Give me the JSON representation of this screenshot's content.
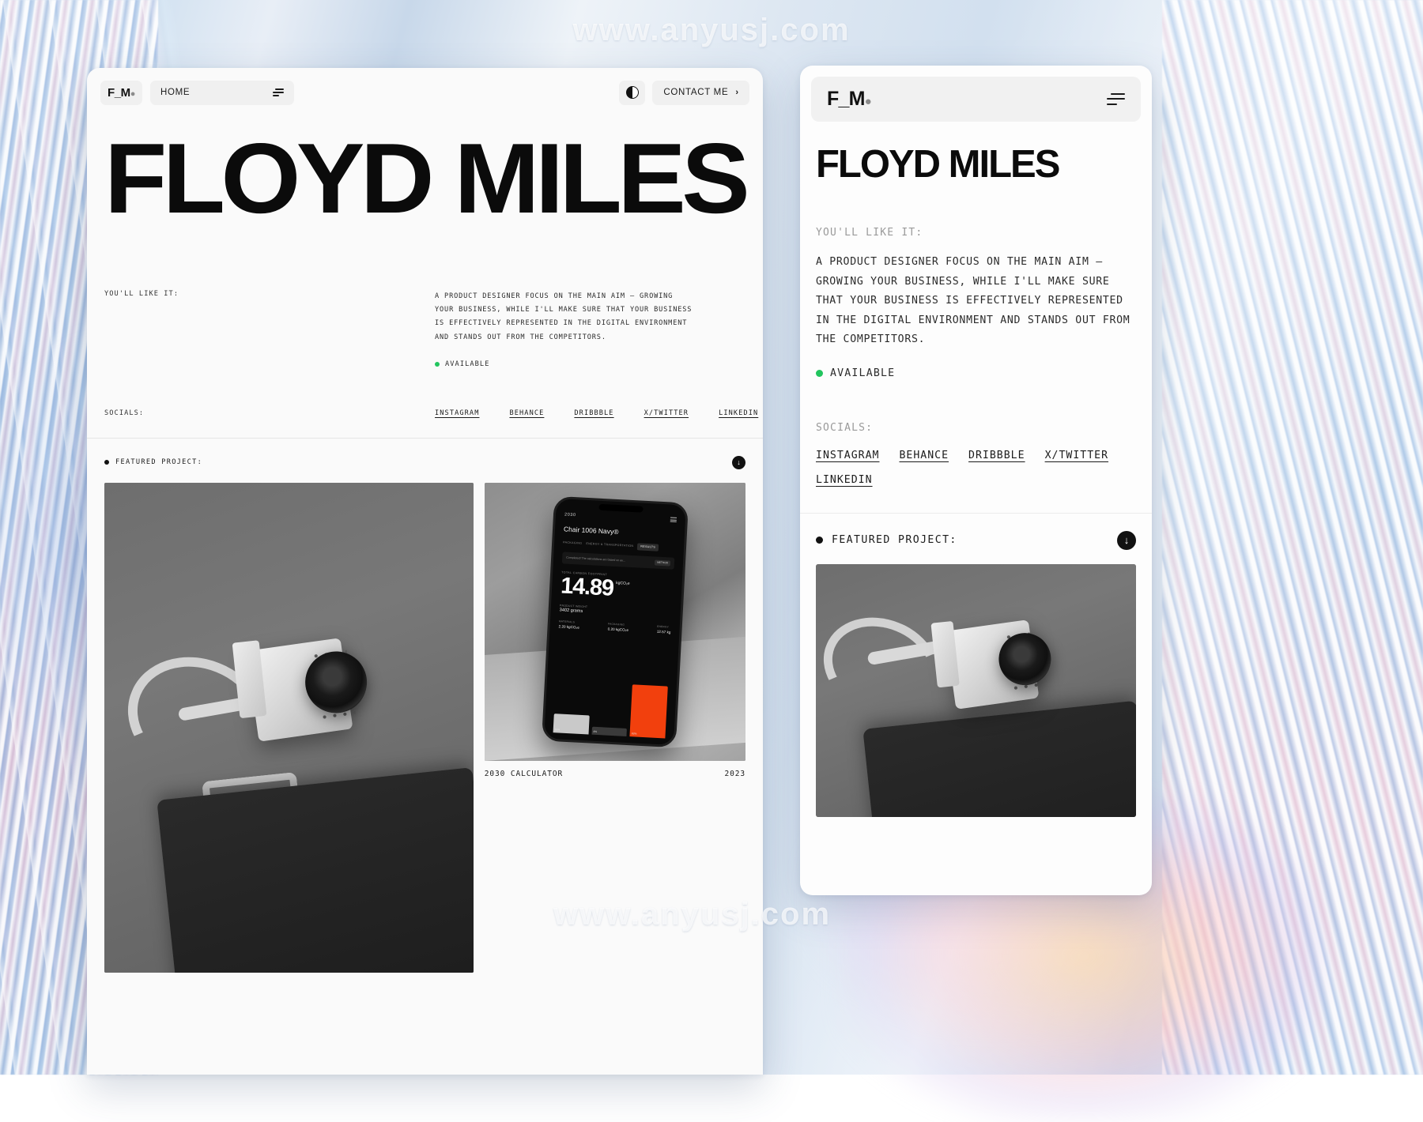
{
  "watermark": {
    "top": "www.anyusj.com",
    "mid": "www.anyusj.com"
  },
  "desktop": {
    "nav": {
      "logo": "F_M",
      "logo_dot": "●",
      "home_label": "HOME",
      "filter_icon": "filter-lines-icon",
      "theme_icon": "contrast-circle-icon",
      "contact_label": "CONTACT ME",
      "contact_chevron": "›"
    },
    "hero": {
      "title": "FLOYD MILES"
    },
    "intro": {
      "label": "YOU'LL LIKE IT:",
      "description": "A PRODUCT DESIGNER FOCUS ON THE MAIN AIM — GROWING YOUR BUSINESS, WHILE I'LL MAKE SURE THAT YOUR BUSINESS IS EFFECTIVELY REPRESENTED IN THE DIGITAL ENVIRONMENT AND STANDS OUT FROM THE COMPETITORS.",
      "status": "AVAILABLE",
      "status_color": "#22c55e"
    },
    "socials": {
      "label": "SOCIALS:",
      "links": [
        "INSTAGRAM",
        "BEHANCE",
        "DRIBBBLE",
        "X/TWITTER",
        "LINKEDIN"
      ]
    },
    "featured": {
      "label": "FEATURED PROJECT:",
      "download_icon": "download-arrow-icon",
      "download_glyph": "↓",
      "project_caption": "2030 CALCULATOR",
      "project_year": "2023"
    },
    "phone_mockup": {
      "brand": "2030",
      "title": "Chair 1006 Navy®",
      "tabs": [
        "PACKAGING",
        "ENERGY & TRANSPORTATION",
        "RESULTS"
      ],
      "active_tab": "RESULTS",
      "note": "Completed! The calculations are based on av...",
      "note_badge": "METHOD",
      "metric_label": "TOTAL CARBON FOOTPRINT",
      "metric_value": "14.89",
      "metric_unit": "kgCO₂e",
      "weight_label": "PRODUCT WEIGHT",
      "weight_value": "3402 grams",
      "stats": [
        {
          "label": "MATERIALS",
          "value": "2.20 kgCO₂e",
          "percent": "16%"
        },
        {
          "label": "PACKAGING",
          "value": "0.20 kgCO₂e",
          "percent": "4%"
        },
        {
          "label": "ENERGY",
          "value": "12.57 kg",
          "percent": "82%"
        }
      ],
      "bar_color": "#f2400d"
    }
  },
  "mobile": {
    "nav": {
      "logo": "F_M",
      "logo_dot": "●",
      "menu_icon": "filter-lines-icon"
    },
    "hero": {
      "title": "FLOYD MILES"
    },
    "intro": {
      "label": "YOU'LL LIKE IT:",
      "description": "A PRODUCT DESIGNER FOCUS ON THE MAIN AIM — GROWING YOUR BUSINESS, WHILE I'LL MAKE SURE THAT YOUR BUSINESS IS EFFECTIVELY REPRESENTED IN THE DIGITAL ENVIRONMENT AND STANDS OUT FROM THE COMPETITORS.",
      "status": "AVAILABLE"
    },
    "socials": {
      "label": "SOCIALS:",
      "links": [
        "INSTAGRAM",
        "BEHANCE",
        "DRIBBBLE",
        "X/TWITTER",
        "LINKEDIN"
      ]
    },
    "featured": {
      "label": "FEATURED PROJECT:",
      "download_glyph": "↓"
    }
  }
}
